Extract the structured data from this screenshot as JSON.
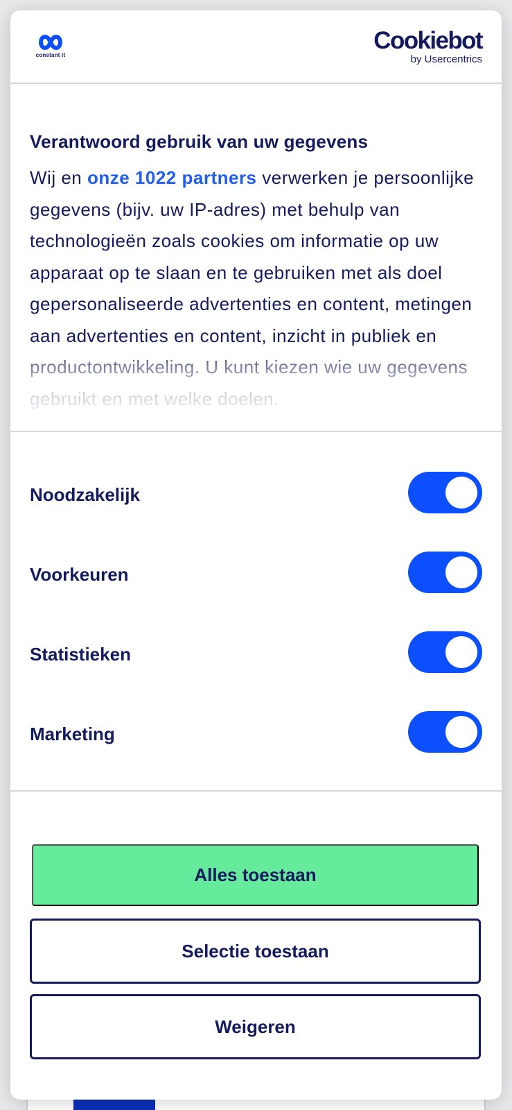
{
  "header": {
    "brand_name": "constant it",
    "cookiebot_name": "Cookiebot",
    "cookiebot_sub": "by Usercentrics"
  },
  "content": {
    "title": "Verantwoord gebruik van uw gegevens",
    "text_before_link": "Wij en ",
    "partners_link": "onze 1022 partners",
    "text_after_link": " verwerken je persoonlijke gegevens (bijv. uw IP-adres) met behulp van technologieën zoals cookies om informatie op uw apparaat op te slaan en te gebruiken met als doel gepersonaliseerde advertenties en content, metingen aan advertenties en content, inzicht in publiek en productontwikkeling. U kunt kiezen wie uw gegevens gebruikt en met welke doelen."
  },
  "toggles": [
    {
      "label": "Noodzakelijk",
      "on": true
    },
    {
      "label": "Voorkeuren",
      "on": true
    },
    {
      "label": "Statistieken",
      "on": true
    },
    {
      "label": "Marketing",
      "on": true
    }
  ],
  "buttons": {
    "allow_all": "Alles toestaan",
    "allow_selection": "Selectie toestaan",
    "deny": "Weigeren"
  },
  "colors": {
    "primary_text": "#141a5e",
    "link": "#1f5ef0",
    "toggle_on": "#0b4fff",
    "allow_all_bg": "#66ea9c"
  }
}
